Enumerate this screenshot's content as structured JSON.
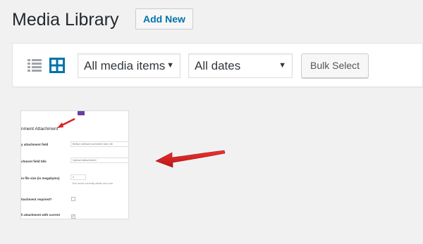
{
  "header": {
    "title": "Media Library",
    "add_new_label": "Add New"
  },
  "toolbar": {
    "view_modes": [
      "list-view-icon",
      "grid-view-icon"
    ],
    "media_filter": {
      "selected": "All media items"
    },
    "date_filter": {
      "selected": "All dates"
    },
    "bulk_select_label": "Bulk Select"
  },
  "attachment_thumbnail": {
    "heading": "nment Attachment",
    "rows": [
      {
        "label": "y attachment field",
        "value": "Before default comment form fie"
      },
      {
        "label": "chment field title",
        "value": "Upload attachment"
      },
      {
        "label": "m file size (in megabytes)",
        "value": "2",
        "help": "Your server currently allows us to use"
      },
      {
        "label": "ttachment required?"
      },
      {
        "label": "h attachment with current"
      }
    ]
  },
  "colors": {
    "accent": "#0073aa",
    "arrow": "#dd2222",
    "background": "#f1f1f1"
  }
}
